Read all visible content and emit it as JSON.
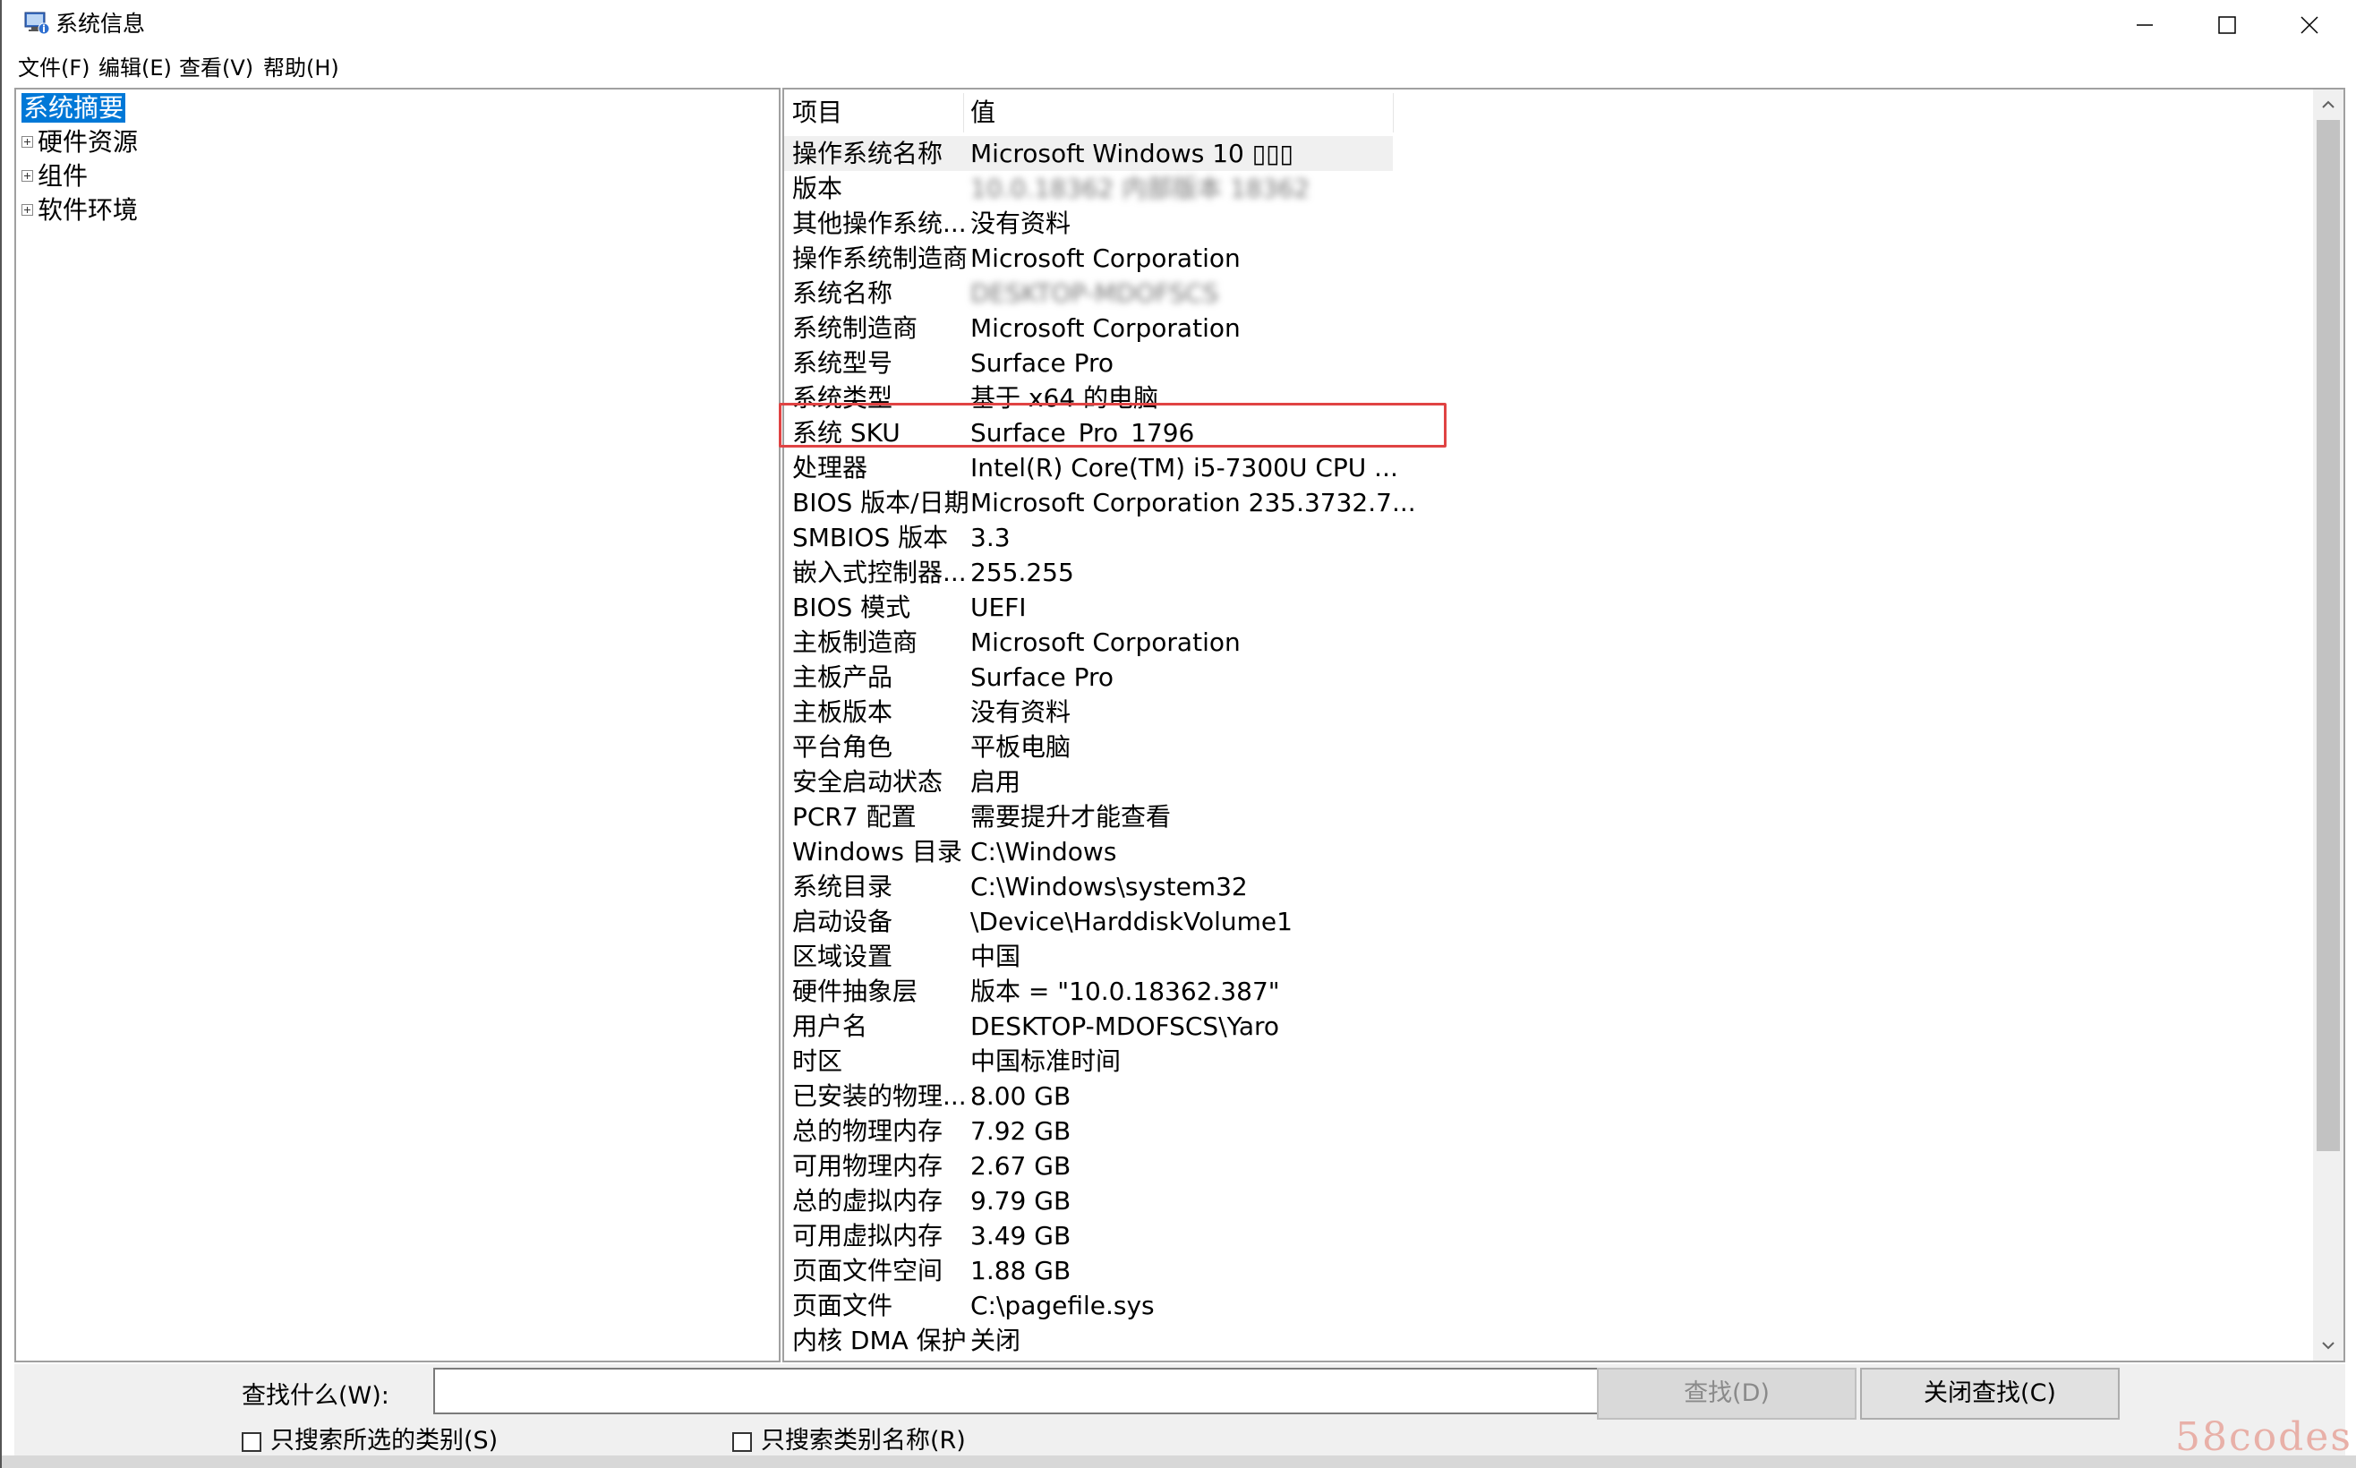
{
  "window": {
    "title": "系统信息",
    "icon": "system-info-icon"
  },
  "menu": {
    "file": "文件(F)",
    "edit": "编辑(E)",
    "view": "查看(V)",
    "help": "帮助(H)"
  },
  "tree": {
    "items": [
      {
        "label": "系统摘要",
        "selected": true
      },
      {
        "label": "硬件资源"
      },
      {
        "label": "组件"
      },
      {
        "label": "软件环境"
      }
    ]
  },
  "list": {
    "header": {
      "name": "项目",
      "value": "值"
    },
    "rows": [
      {
        "name": "操作系统名称",
        "value": "Microsoft Windows 10 ▯▯▯"
      },
      {
        "name": "版本",
        "value": "10.0.18362 内部版本 18362"
      },
      {
        "name": "其他操作系统...",
        "value": "没有资料"
      },
      {
        "name": "操作系统制造商",
        "value": "Microsoft Corporation"
      },
      {
        "name": "系统名称",
        "value": "DESKTOP-MDOFSCS"
      },
      {
        "name": "系统制造商",
        "value": "Microsoft Corporation"
      },
      {
        "name": "系统型号",
        "value": "Surface Pro"
      },
      {
        "name": "系统类型",
        "value": "基于 x64 的电脑"
      },
      {
        "name": "系统 SKU",
        "value": "Surface_Pro_1796"
      },
      {
        "name": "处理器",
        "value": "Intel(R) Core(TM) i5-7300U CPU ..."
      },
      {
        "name": "BIOS 版本/日期",
        "value": "Microsoft Corporation 235.3732.7..."
      },
      {
        "name": "SMBIOS 版本",
        "value": "3.3"
      },
      {
        "name": "嵌入式控制器...",
        "value": "255.255"
      },
      {
        "name": "BIOS 模式",
        "value": "UEFI"
      },
      {
        "name": "主板制造商",
        "value": "Microsoft Corporation"
      },
      {
        "name": "主板产品",
        "value": "Surface Pro"
      },
      {
        "name": "主板版本",
        "value": "没有资料"
      },
      {
        "name": "平台角色",
        "value": "平板电脑"
      },
      {
        "name": "安全启动状态",
        "value": "启用"
      },
      {
        "name": "PCR7 配置",
        "value": "需要提升才能查看"
      },
      {
        "name": "Windows 目录",
        "value": "C:\\Windows"
      },
      {
        "name": "系统目录",
        "value": "C:\\Windows\\system32"
      },
      {
        "name": "启动设备",
        "value": "\\Device\\HarddiskVolume1"
      },
      {
        "name": "区域设置",
        "value": "中国"
      },
      {
        "name": "硬件抽象层",
        "value": "版本 = \"10.0.18362.387\""
      },
      {
        "name": "用户名",
        "value": "DESKTOP-MDOFSCS\\Yaro"
      },
      {
        "name": "时区",
        "value": "中国标准时间"
      },
      {
        "name": "已安装的物理...",
        "value": "8.00 GB"
      },
      {
        "name": "总的物理内存",
        "value": "7.92 GB"
      },
      {
        "name": "可用物理内存",
        "value": "2.67 GB"
      },
      {
        "name": "总的虚拟内存",
        "value": "9.79 GB"
      },
      {
        "name": "可用虚拟内存",
        "value": "3.49 GB"
      },
      {
        "name": "页面文件空间",
        "value": "1.88 GB"
      },
      {
        "name": "页面文件",
        "value": "C:\\pagefile.sys"
      },
      {
        "name": "内核 DMA 保护",
        "value": "关闭"
      }
    ]
  },
  "search": {
    "label": "查找什么(W):",
    "value": "",
    "find_button": "查找(D)",
    "close_button": "关闭查找(C)",
    "check_selected": "只搜索所选的类别(S)",
    "check_names": "只搜索类别名称(R)"
  },
  "watermark": "58codes"
}
